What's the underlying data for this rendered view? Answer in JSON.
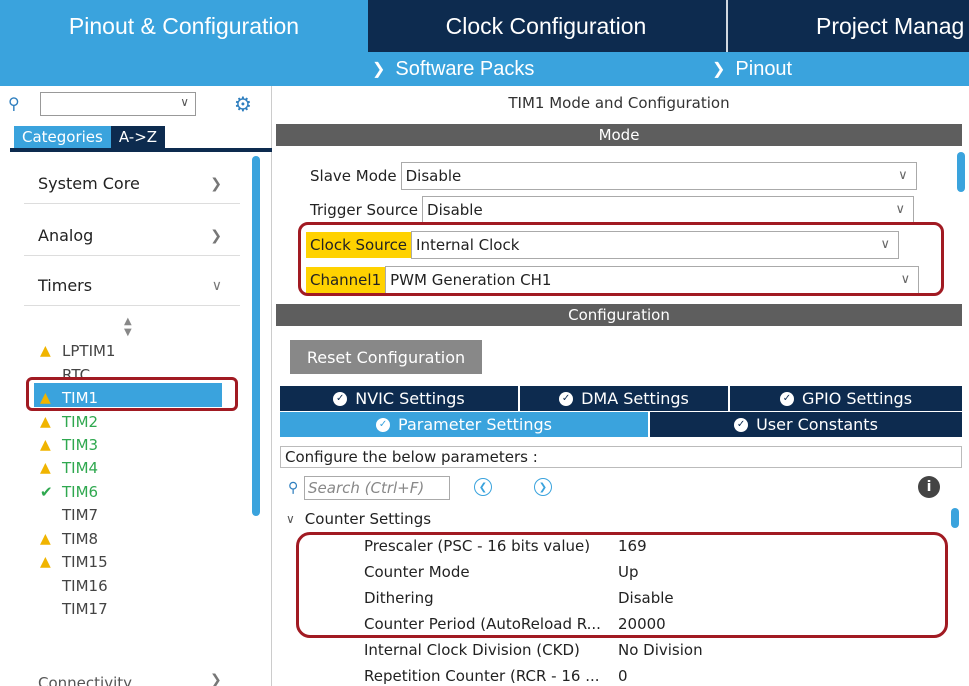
{
  "tabs": {
    "pinout": "Pinout & Configuration",
    "clock": "Clock Configuration",
    "project": "Project Manag"
  },
  "submenus": {
    "software_packs": "Software Packs",
    "pinout": "Pinout"
  },
  "left": {
    "category_tab": "Categories",
    "az_tab": "A->Z",
    "categories": [
      "System Core",
      "Analog",
      "Timers"
    ],
    "connectivity": "Connectivity",
    "timers": [
      {
        "label": "LPTIM1",
        "status": "warn"
      },
      {
        "label": "RTC",
        "status": "none"
      },
      {
        "label": "TIM1",
        "status": "warn"
      },
      {
        "label": "TIM2",
        "status": "warn"
      },
      {
        "label": "TIM3",
        "status": "warn"
      },
      {
        "label": "TIM4",
        "status": "warn"
      },
      {
        "label": "TIM6",
        "status": "ok"
      },
      {
        "label": "TIM7",
        "status": "none"
      },
      {
        "label": "TIM8",
        "status": "warn"
      },
      {
        "label": "TIM15",
        "status": "warn"
      },
      {
        "label": "TIM16",
        "status": "none"
      },
      {
        "label": "TIM17",
        "status": "none"
      }
    ]
  },
  "right": {
    "title": "TIM1 Mode and Configuration",
    "mode_header": "Mode",
    "config_header": "Configuration",
    "fields": {
      "slave_label": "Slave Mode",
      "slave_value": "Disable",
      "trigger_label": "Trigger Source",
      "trigger_value": "Disable",
      "clock_label": "Clock Source",
      "clock_value": "Internal Clock",
      "channel_label": "Channel1",
      "channel_value": "PWM Generation CH1"
    },
    "reset_button": "Reset Configuration",
    "settings_tabs": {
      "nvic": "NVIC Settings",
      "dma": "DMA Settings",
      "gpio": "GPIO Settings",
      "param": "Parameter Settings",
      "user": "User Constants"
    },
    "hint": "Configure the below parameters :",
    "search_placeholder": "Search (Ctrl+F)",
    "group": "Counter Settings",
    "params": [
      {
        "name": "Prescaler (PSC - 16 bits value)",
        "value": "169"
      },
      {
        "name": "Counter Mode",
        "value": "Up"
      },
      {
        "name": "Dithering",
        "value": "Disable"
      },
      {
        "name": "Counter Period (AutoReload R...",
        "value": "20000"
      },
      {
        "name": "Internal Clock Division (CKD)",
        "value": "No Division"
      },
      {
        "name": "Repetition Counter (RCR - 16 ...",
        "value": "0"
      }
    ]
  }
}
